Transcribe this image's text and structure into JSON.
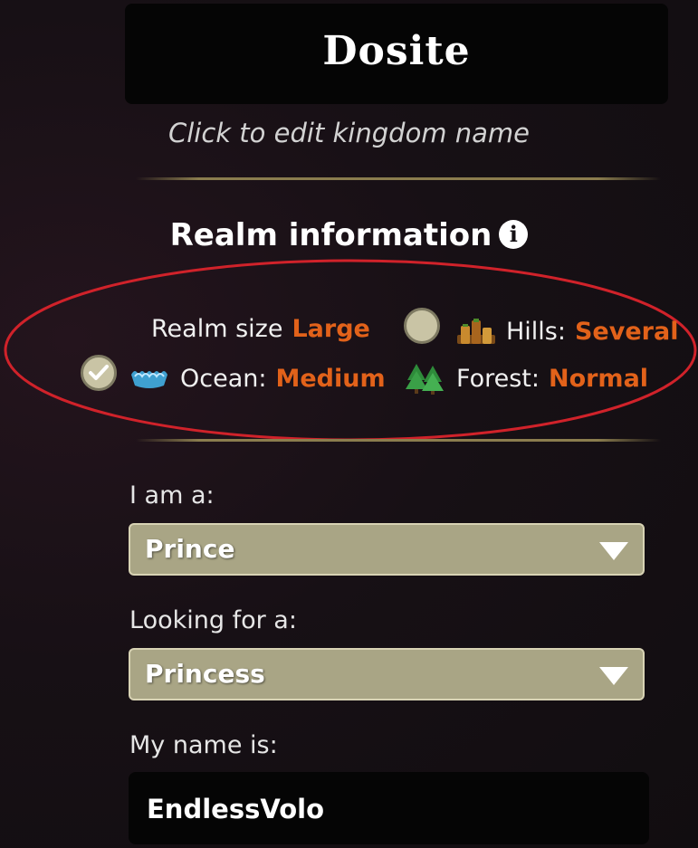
{
  "kingdom": {
    "name": "Dosite",
    "edit_hint": "Click to edit kingdom name"
  },
  "realm": {
    "heading": "Realm information",
    "info_icon": "info-circle-icon",
    "size": {
      "label": "Realm size",
      "value": "Large"
    },
    "hills": {
      "label": "Hills:",
      "value": "Several",
      "checked": false,
      "icon": "hills-icon"
    },
    "ocean": {
      "label": "Ocean:",
      "value": "Medium",
      "checked": true,
      "icon": "ocean-icon"
    },
    "forest": {
      "label": "Forest:",
      "value": "Normal",
      "icon": "forest-icon"
    }
  },
  "form": {
    "i_am_label": "I am a:",
    "i_am_value": "Prince",
    "looking_for_label": "Looking for a:",
    "looking_for_value": "Princess",
    "name_label": "My name is:",
    "name_value": "EndlessVolo"
  },
  "colors": {
    "accent_orange": "#e2621a",
    "select_bg": "#a9a585",
    "highlight_red": "#d0222a"
  }
}
